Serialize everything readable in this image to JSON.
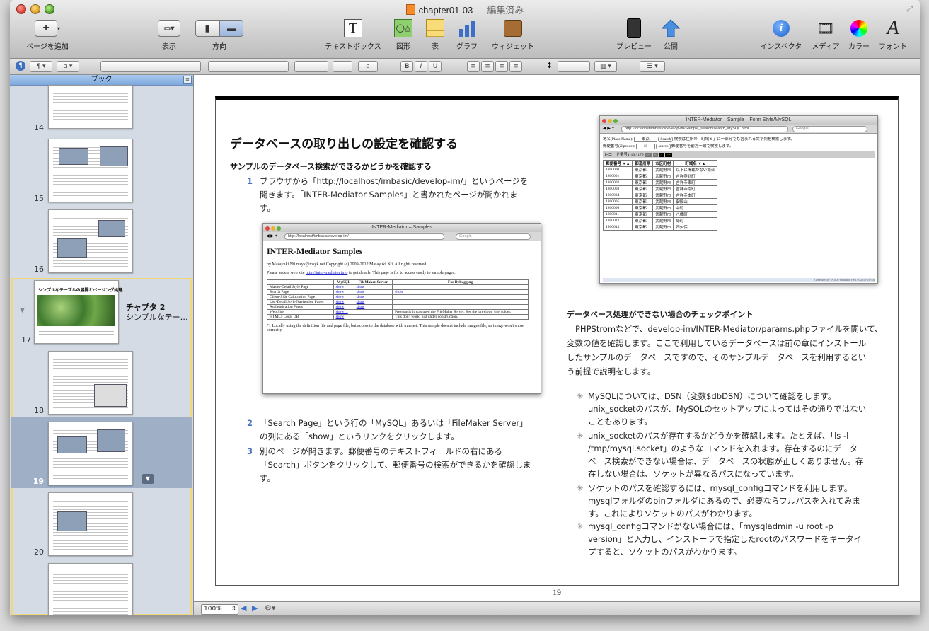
{
  "window": {
    "title": "chapter01-03",
    "title_sep": " — ",
    "status": "編集済み"
  },
  "toolbar": {
    "add_page": "ページを追加",
    "view": "表示",
    "orientation": "方向",
    "textbox": "テキストボックス",
    "shapes": "図形",
    "table": "表",
    "graph": "グラフ",
    "widget": "ウィジェット",
    "preview": "プレビュー",
    "publish": "公開",
    "inspector": "インスペクタ",
    "media": "メディア",
    "color": "カラー",
    "font": "フォント"
  },
  "formatbar": {
    "para_style": "¶",
    "char_style": "a",
    "char_style_btn": "a",
    "bold": "B",
    "italic": "I",
    "underline": "U"
  },
  "sidebar": {
    "header": "ブック",
    "pages": [
      {
        "num": "14"
      },
      {
        "num": "15"
      },
      {
        "num": "16"
      },
      {
        "num": "17",
        "chapter": "チャプタ 2",
        "chapter_title": "シンプルなテー…",
        "thumb_title": "シンプルなテーブルの展開とページング処理"
      },
      {
        "num": "18"
      },
      {
        "num": "19"
      },
      {
        "num": "20"
      }
    ]
  },
  "page": {
    "heading": "データベースの取り出しの設定を確認する",
    "subheading": "サンプルのデータベース検索ができるかどうかを確認する",
    "steps": [
      {
        "n": "1",
        "line1": "ブラウザから「http://localhost/imbasic/develop-im/」というページを",
        "line2": "開きます。「INTER-Mediator Samples」と書かれたページが開かれま",
        "line3": "す。"
      },
      {
        "n": "2",
        "line1": "「Search Page」という行の「MySQL」あるいは「FileMaker Server」",
        "line2": "の列にある「show」というリンクをクリックします。"
      },
      {
        "n": "3",
        "line1": "別のページが開きます。郵便番号のテキストフィールドの右にある",
        "line2": "「Search」ボタンをクリックして、郵便番号の検索ができるかを確認しま",
        "line3": "す。"
      }
    ],
    "right_heading": "データベース処理ができない場合のチェックポイント",
    "right_para": [
      "PHPStromなどで、develop-im/INTER-Mediator/params.phpファイルを開いて、",
      "変数の値を確認します。ここで利用しているデータベースは前の章にインストール",
      "したサンプルのデータベースですので、そのサンプルデータベースを利用するとい",
      "う前提で説明をします。"
    ],
    "bullets": [
      [
        "MySQLについては、DSN（変数$dbDSN）について確認をします。",
        "unix_socketのパスが、MySQLのセットアップによってはその通りではない",
        "こともあります。"
      ],
      [
        "unix_socketのパスが存在するかどうかを確認します。たとえば、「ls -l",
        "/tmp/mysql.socket」のようなコマンドを入れます。存在するのにデータ",
        "ベース検索ができない場合は、データベースの状態が正しくありません。存",
        "在しない場合は、ソケットが異なるパスになっています。"
      ],
      [
        "ソケットのパスを確認するには、mysql_configコマンドを利用します。",
        "mysqlフォルダのbinフォルダにあるので、必要ならフルパスを入れてみま",
        "す。これによりソケットのパスがわかります。"
      ],
      [
        "mysql_configコマンドがない場合には、「mysqladmin -u root -p",
        "version」と入力し、インストーラで指定したrootのパスワードをキータイ",
        "プすると、ソケットのパスがわかります。"
      ]
    ],
    "page_number": "19"
  },
  "browser1": {
    "title": "INTER-Mediator – Samples",
    "url": "http://localhost/imbasic/develop-im/",
    "search": "Google",
    "heading": "INTER-Mediator Samples",
    "byline": "by Masayuki Nii msyk@msyk.net Copyright (c) 2009-2012 Masayuki Nii, All rights reserved.",
    "access_pre": "Please access web site ",
    "access_link": "http://inter-mediator.info",
    "access_post": " to get details. This page is for to access easily to sample pages.",
    "cols": [
      "",
      "MySQL",
      "FileMaker Server",
      "For Debugging"
    ],
    "rows": [
      [
        "Master-Detail Style Page",
        "show",
        "show",
        ""
      ],
      [
        "Search Page",
        "show",
        "show",
        "show"
      ],
      [
        "Client-Side Calucration Page",
        "show",
        "show",
        ""
      ],
      [
        "List-Detail Style Navigation Pages",
        "show",
        "show",
        ""
      ],
      [
        "Authentication Pages",
        "show",
        "show",
        ""
      ],
      [
        "Web Site",
        "show*1",
        "",
        "Previously it was used the FileMaker Server. See the 'previous_site' folder."
      ],
      [
        "HTML5 Local DB",
        "show",
        "",
        "This don't work, just under construction."
      ]
    ],
    "footnote": "*1 Locally using the definition file and page file, but access to the database with internet. This sample doesn't include images file, so image won't show correctly."
  },
  "browser2": {
    "title": "INTER-Mediator – Sample – Form Style/MySQL",
    "url": "http://localhost/imbasic/develop-im/Sample_search/search_MySQL.html",
    "search": "Google",
    "place_label": "地名(Place Name):",
    "place_value": "東京",
    "place_btn": "Search",
    "place_note": "検索は住所の「町域名」に一部分でも含まれる文字列を検索します。",
    "zip_label": "郵便番号(Zipcode):",
    "zip_value": "18",
    "zip_btn": "search",
    "zip_note": "郵便番号を前方一致で検索します。",
    "record_info": "レコード番号1-10 / 179",
    "cols": [
      "郵便番号 ▼▲",
      "都道府県",
      "市区町村",
      "町域名 ▼▲"
    ],
    "rows": [
      [
        "1800000",
        "東京都",
        "武蔵野市",
        "以下に掲載がない場合"
      ],
      [
        "1800001",
        "東京都",
        "武蔵野市",
        "吉祥寺北町"
      ],
      [
        "1800002",
        "東京都",
        "武蔵野市",
        "吉祥寺東町"
      ],
      [
        "1800003",
        "東京都",
        "武蔵野市",
        "吉祥寺南町"
      ],
      [
        "1800004",
        "東京都",
        "武蔵野市",
        "吉祥寺本町"
      ],
      [
        "1800005",
        "東京都",
        "武蔵野市",
        "御殿山"
      ],
      [
        "1800006",
        "東京都",
        "武蔵野市",
        "中町"
      ],
      [
        "1800011",
        "東京都",
        "武蔵野市",
        "八幡町"
      ],
      [
        "1800012",
        "東京都",
        "武蔵野市",
        "緑町"
      ],
      [
        "1800013",
        "東京都",
        "武蔵野市",
        "西久保"
      ]
    ],
    "footer": "Generated by INTER-Mediator Ver.1.0 (2012-03-30)"
  },
  "statusbar": {
    "zoom": "100%"
  },
  "colors": {
    "accent": "#4a72c0",
    "sidebar_header": "#8fb5e6",
    "section_border": "#f0d77a"
  }
}
